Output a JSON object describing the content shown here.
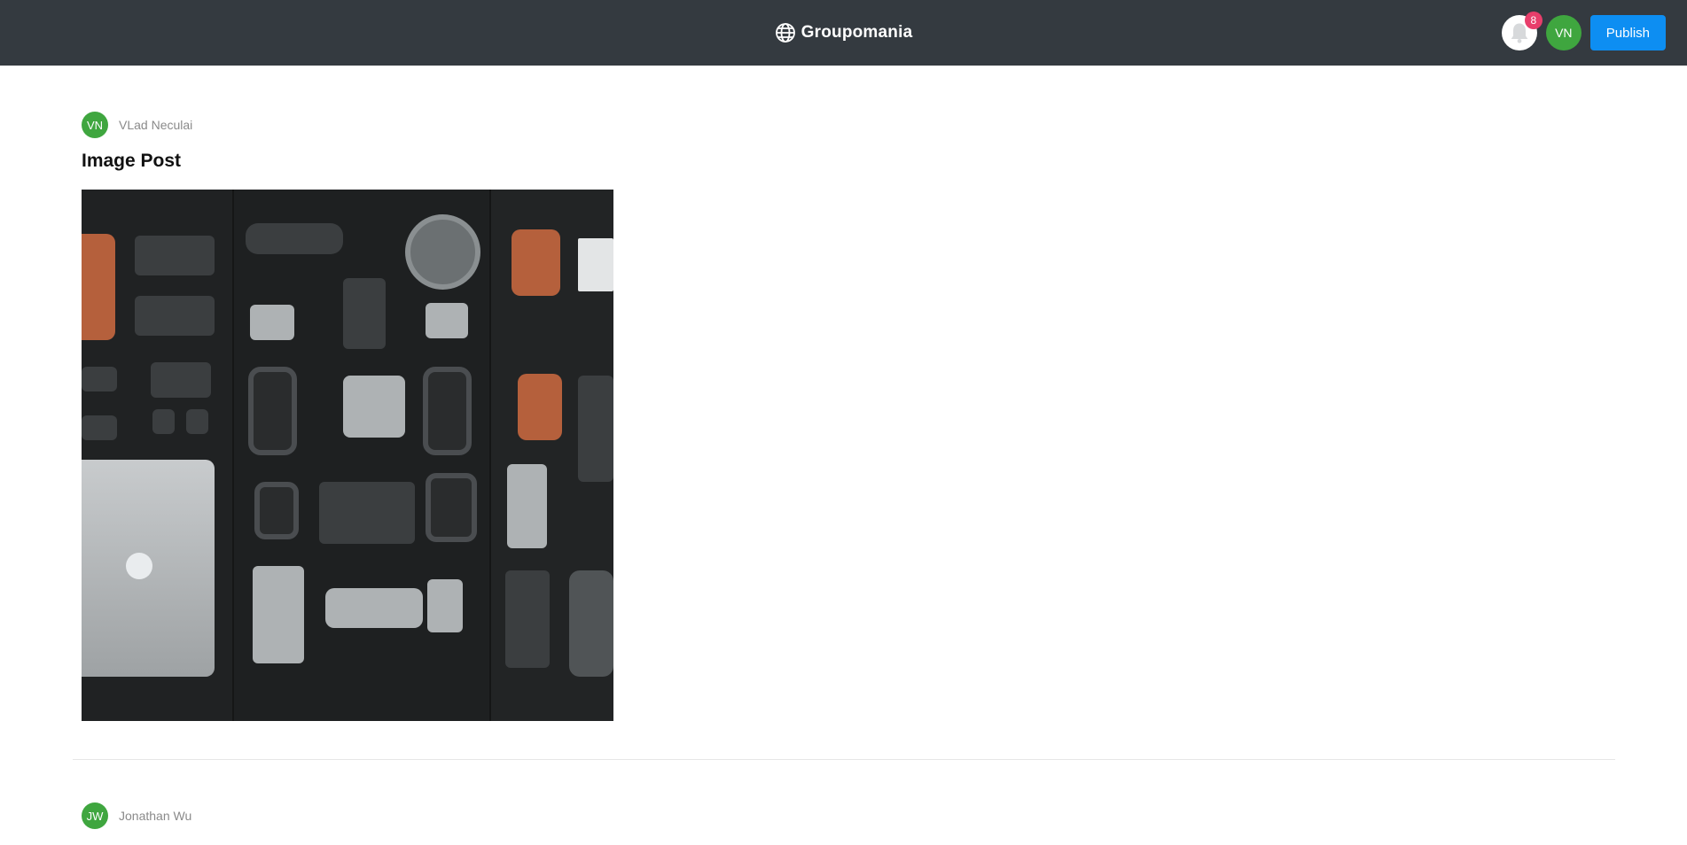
{
  "header": {
    "brand": "Groupomania",
    "notification_count": "8",
    "user_initials": "VN",
    "publish_label": "Publish"
  },
  "posts": [
    {
      "author_initials": "VN",
      "author_name": "VLad Neculai",
      "title": "Image Post"
    },
    {
      "author_initials": "JW",
      "author_name": "Jonathan Wu"
    }
  ],
  "colors": {
    "header_bg": "#343a40",
    "avatar_green": "#3fa63f",
    "publish_blue": "#0d8ef2",
    "badge_pink": "#e83e6b"
  }
}
